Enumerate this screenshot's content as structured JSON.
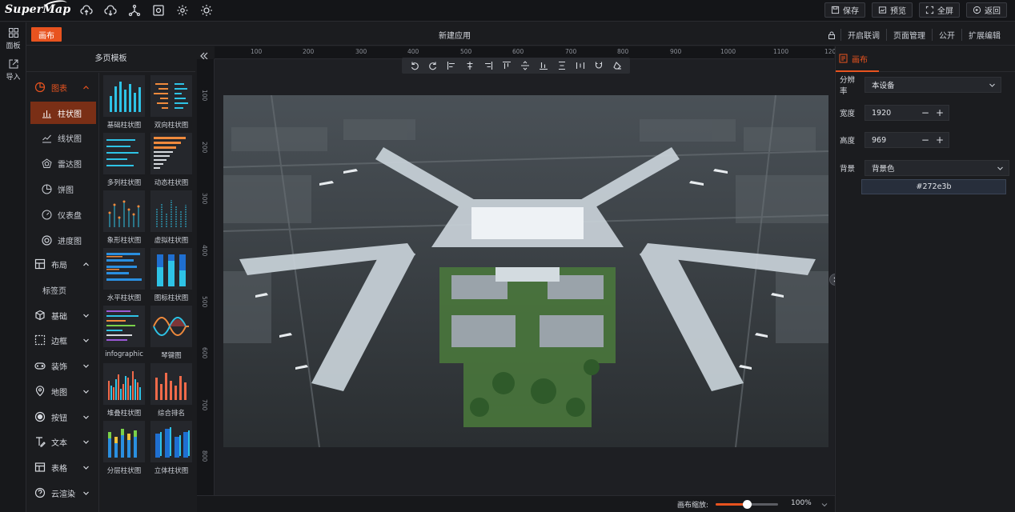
{
  "app": {
    "logo_text": "SuperMap"
  },
  "top_actions": [
    {
      "label": "保存",
      "icon": "save-icon"
    },
    {
      "label": "预览",
      "icon": "preview-icon"
    },
    {
      "label": "全屏",
      "icon": "fullscreen-icon"
    },
    {
      "label": "返回",
      "icon": "back-icon"
    }
  ],
  "secondbar": {
    "canvas_tag": "画布",
    "title": "新建应用",
    "actions": [
      "开启联调",
      "页面管理",
      "公开",
      "扩展编辑"
    ]
  },
  "rail": [
    {
      "label": "面板",
      "icon": "panel-icon"
    },
    {
      "label": "导入",
      "icon": "import-icon"
    }
  ],
  "panel": {
    "header": "多页模板"
  },
  "categories": {
    "chart": "图表",
    "chart_subs": [
      "柱状图",
      "线状图",
      "雷达图",
      "饼图",
      "仪表盘",
      "进度图"
    ],
    "layout": "布局",
    "layout_subs": [
      "标签页"
    ],
    "basic": "基础",
    "border": "边框",
    "decor": "装饰",
    "map": "地图",
    "button": "按钮",
    "text": "文本",
    "table": "表格",
    "cloud": "云渲染"
  },
  "thumbnails": [
    "基础柱状图",
    "双向柱状图",
    "多列柱状图",
    "动态柱状图",
    "象形柱状图",
    "虚拟柱状图",
    "水平柱状图",
    "图标柱状图",
    "infographic",
    "琴键图",
    "堆叠柱状图",
    "综合排名",
    "分层柱状图",
    "立体柱状图"
  ],
  "ruler": {
    "top": [
      "100",
      "200",
      "300",
      "400",
      "500",
      "600",
      "700",
      "800",
      "900",
      "1000",
      "1100",
      "120"
    ],
    "left": [
      "100",
      "200",
      "300",
      "400",
      "500",
      "600",
      "700",
      "800"
    ]
  },
  "bottom": {
    "zoom_label": "画布缩放:",
    "zoom_value": "100%",
    "zoom_fraction": 0.5
  },
  "right_panel": {
    "tab": "画布",
    "resolution_label": "分辨率",
    "resolution_value": "本设备",
    "width_label": "宽度",
    "width_value": "1920",
    "height_label": "高度",
    "height_value": "969",
    "bg_label": "背景",
    "bg_value": "背景色",
    "bg_color": "#272e3b"
  },
  "colors": {
    "accent": "#e8531f",
    "bg": "#1b1c1f"
  }
}
